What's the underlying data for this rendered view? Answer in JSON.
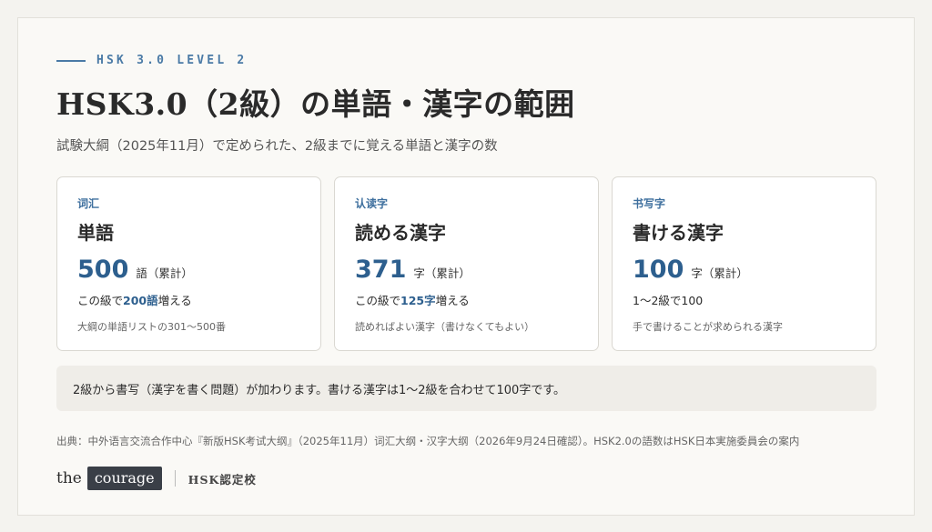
{
  "header": {
    "eyebrow": "HSK 3.0 LEVEL 2",
    "title": "HSK3.0（2級）の単語・漢字の範囲",
    "subtitle": "試験大綱（2025年11月）で定められた、2級までに覚える単語と漢字の数"
  },
  "cards": [
    {
      "tag": "词汇",
      "name": "単語",
      "count": "500",
      "unit": "語（累計）",
      "delta_prefix": "この級で",
      "delta_highlight": "200語",
      "delta_suffix": "増える",
      "note": "大綱の単語リストの301〜500番"
    },
    {
      "tag": "认读字",
      "name": "読める漢字",
      "count": "371",
      "unit": "字（累計）",
      "delta_prefix": "この級で",
      "delta_highlight": "125字",
      "delta_suffix": "増える",
      "note": "読めればよい漢字（書けなくてもよい）"
    },
    {
      "tag": "书写字",
      "name": "書ける漢字",
      "count": "100",
      "unit": "字（累計）",
      "delta_prefix": "1〜2級で100",
      "delta_highlight": "",
      "delta_suffix": "",
      "note": "手で書けることが求められる漢字"
    }
  ],
  "banner": "2級から書写（漢字を書く問題）が加わります。書ける漢字は1〜2級を合わせて100字です。",
  "source": "出典：中外语言交流合作中心『新版HSK考试大纲』（2025年11月）词汇大纲・汉字大纲（2026年9月24日確認）。HSK2.0の語数はHSK日本実施委員会の案内",
  "logo": {
    "the": "the",
    "box": "courage",
    "school": "HSK認定校"
  },
  "colors": {
    "accent": "#2d5f8e",
    "eyebrow": "#4a7aa6",
    "logo_box": "#3a3f47"
  }
}
